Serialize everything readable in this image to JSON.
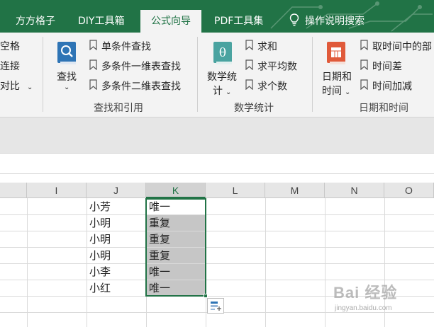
{
  "tabs": [
    {
      "label": "方方格子",
      "active": false
    },
    {
      "label": "DIY工具箱",
      "active": false
    },
    {
      "label": "公式向导",
      "active": true
    },
    {
      "label": "PDF工具集",
      "active": false
    },
    {
      "label": "操作说明搜索",
      "active": false
    }
  ],
  "colors": {
    "ribbon_green": "#217346",
    "ribbon_bg": "#f3f3f3",
    "selection": "#217346",
    "selected_fill": "#c6c6c6"
  },
  "ribbon": {
    "cut_group": {
      "items": [
        "空格",
        "连接",
        "对比"
      ]
    },
    "lookup": {
      "big_button_line1": "查找",
      "items": [
        "单条件查找",
        "多条件一维表查找",
        "多条件二维表查找"
      ],
      "group_label": "查找和引用",
      "icon": "book-search-icon"
    },
    "math": {
      "big_button_line1": "数学统",
      "big_button_line2": "计",
      "items": [
        "求和",
        "求平均数",
        "求个数"
      ],
      "group_label": "数学统计",
      "icon": "theta-book-icon"
    },
    "datetime": {
      "big_button_line1": "日期和",
      "big_button_line2": "时间",
      "items": [
        "取时间中的部",
        "时间差",
        "时间加减"
      ],
      "group_label": "日期和时间",
      "icon": "calendar-icon"
    }
  },
  "grid": {
    "columns": [
      "I",
      "J",
      "K",
      "L",
      "M",
      "N",
      "O"
    ],
    "selected_column": "K",
    "rows": [
      {
        "J": "小芳",
        "K": "唯一"
      },
      {
        "J": "小明",
        "K": "重复"
      },
      {
        "J": "小明",
        "K": "重复"
      },
      {
        "J": "小明",
        "K": "重复"
      },
      {
        "J": "小李",
        "K": "唯一"
      },
      {
        "J": "小红",
        "K": "唯一"
      }
    ]
  },
  "watermark": {
    "brand": "Bai 经验",
    "url": "jingyan.baidu.com"
  }
}
